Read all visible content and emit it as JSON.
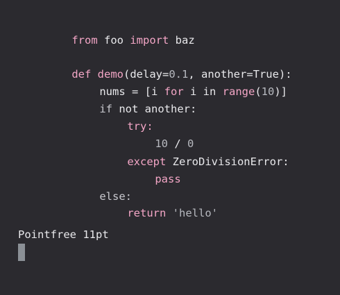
{
  "code": {
    "l1": {
      "from": "from",
      "mod": " foo ",
      "import": "import",
      "name": " baz"
    },
    "l2": {
      "def": "def",
      "space": " ",
      "fname": "demo",
      "open": "(delay=",
      "n1": "0.1",
      "rest": ", another=True):"
    },
    "l3": {
      "a": "nums = [i ",
      "for": "for",
      "b": " i in ",
      "range": "range",
      "c": "(",
      "n": "10",
      "d": ")]"
    },
    "l4": {
      "if": "if",
      "rest": " not another:"
    },
    "l5": {
      "try": "try:"
    },
    "l6": {
      "n10": "10",
      "slash": " / ",
      "n0": "0"
    },
    "l7": {
      "except": "except",
      "rest": " ZeroDivisionError:"
    },
    "l8": {
      "pass": "pass"
    },
    "l9": {
      "else": "else:"
    },
    "l10": {
      "return": "return",
      "space": " ",
      "str": "'hello'"
    }
  },
  "status": {
    "text": "Pointfree 11pt"
  },
  "colors": {
    "background": "#2b2a2f",
    "keyword": "#f3a6c6",
    "number": "#b7b9bf",
    "cursor": "#8b9096"
  }
}
